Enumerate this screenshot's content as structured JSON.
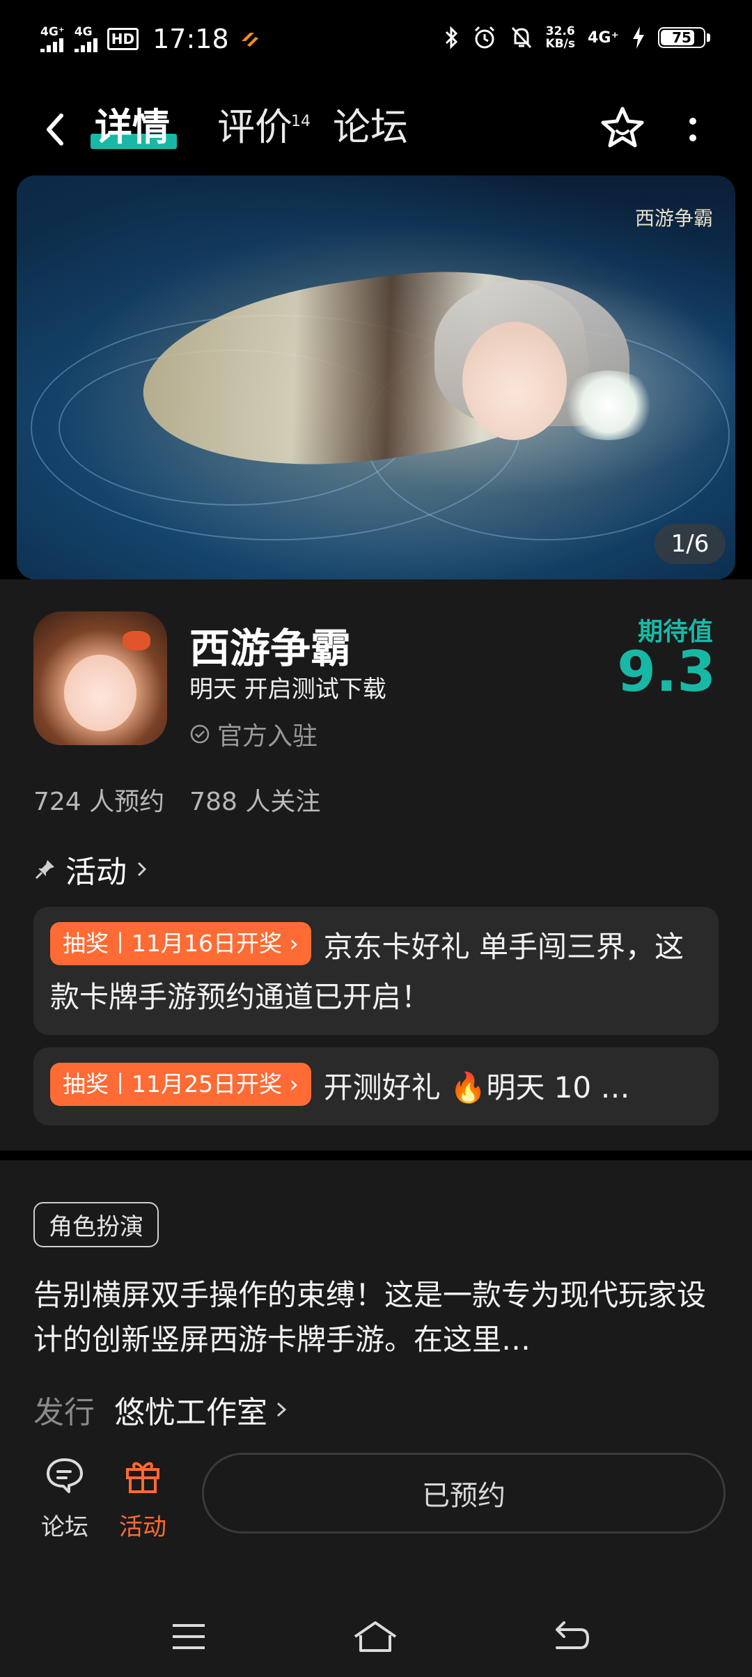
{
  "status_bar": {
    "sig1_tag": "4G⁺",
    "sig2_tag": "4G",
    "hd_label": "HD",
    "time": "17:18",
    "speed_value": "32.6",
    "speed_unit": "KB/s",
    "net_4g": "4G⁺",
    "battery": "75",
    "battery_level": 0.75,
    "icons": [
      "bluetooth-icon",
      "alarm-icon",
      "mute-icon",
      "charging-icon"
    ]
  },
  "header": {
    "back_icon": "back-arrow-icon",
    "tabs": [
      {
        "label": "详情",
        "active": true
      },
      {
        "label": "评价",
        "badge": "14"
      },
      {
        "label": "论坛"
      }
    ],
    "star_icon": "star-outline-icon",
    "more_icon": "more-vertical-icon",
    "accent": "#17b9a6"
  },
  "banner": {
    "logo_text": "西游争霸",
    "pager": "1/6"
  },
  "app": {
    "name": "西游争霸",
    "subtitle": "明天 开启测试下载",
    "official": "官方入驻",
    "expect_label": "期待值",
    "expect_value": "9.3",
    "reservations": "724 人预约",
    "followers": "788 人关注"
  },
  "activities": {
    "heading": "活动",
    "items": [
      {
        "pill": "抽奖丨11月16日开奖",
        "text": "京东卡好礼 单手闯三界，这款卡牌手游预约通道已开启！"
      },
      {
        "pill": "抽奖丨11月25日开奖",
        "text": "开测好礼 🔥明天 10 …"
      }
    ],
    "pill_color": "#ff6b35"
  },
  "details": {
    "genre": "角色扮演",
    "description": "告别横屏双手操作的束缚！这是一款专为现代玩家设计的创新竖屏西游卡牌手游。在这里…",
    "publisher_label": "发行",
    "publisher_value": "悠忧工作室"
  },
  "bottom_bar": {
    "forum_label": "论坛",
    "activity_label": "活动",
    "reserve_label": "已预约"
  },
  "nav": {
    "menu_icon": "menu-icon",
    "home_icon": "home-icon",
    "back_icon": "back-icon"
  }
}
